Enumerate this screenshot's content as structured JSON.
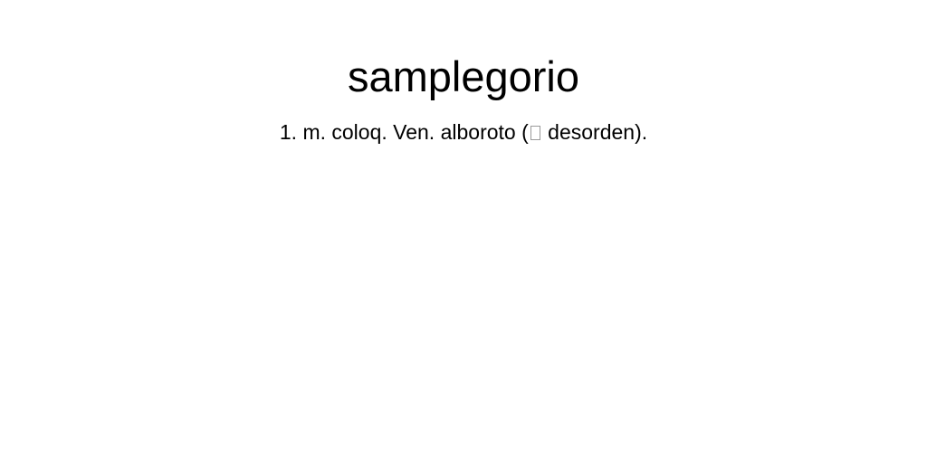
{
  "entry": {
    "headword": "samplegorio",
    "definition": {
      "before": "1. m. coloq. Ven. alboroto (",
      "after": " desorden).",
      "missing_glyph_icon": "missing-glyph-box"
    }
  }
}
